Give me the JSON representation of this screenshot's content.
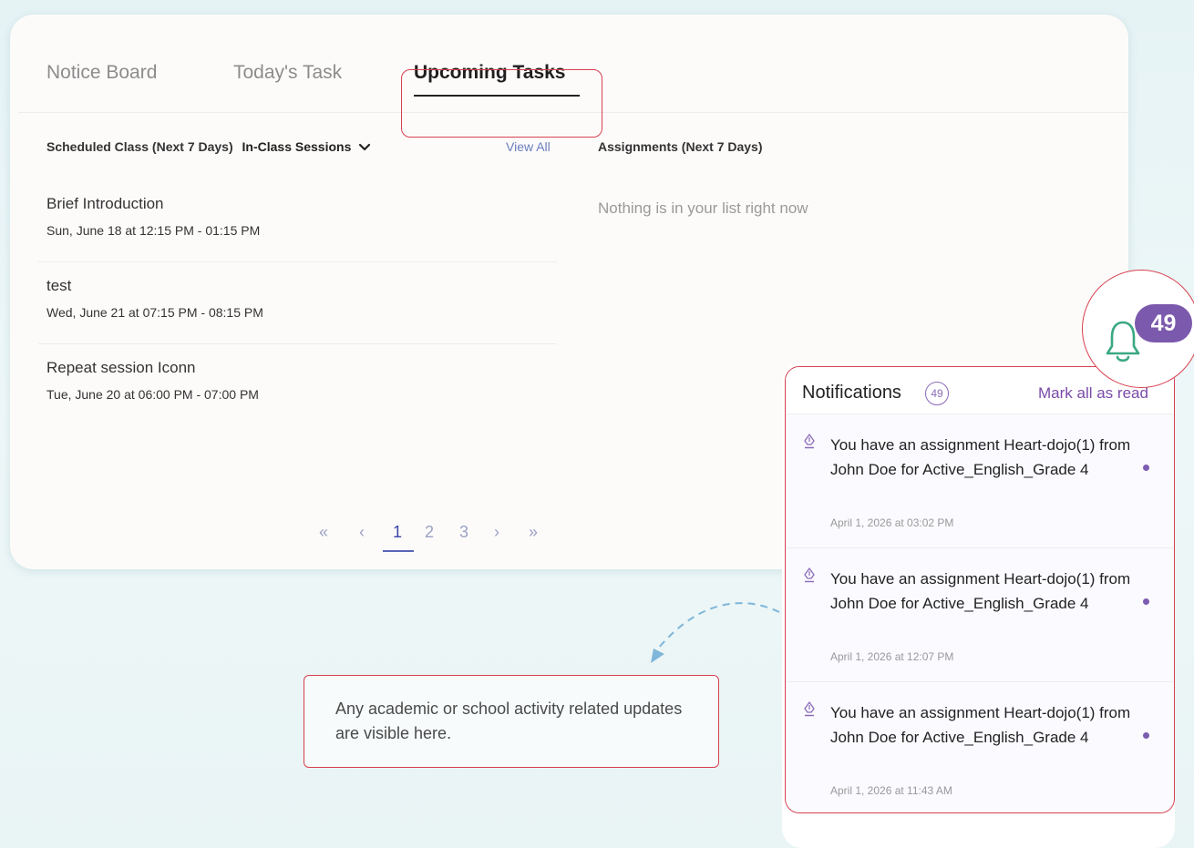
{
  "tabs": [
    {
      "label": "Notice Board"
    },
    {
      "label": "Today's Task"
    },
    {
      "label": "Upcoming Tasks",
      "active": true
    }
  ],
  "scheduled": {
    "heading": "Scheduled Class (Next 7 Days)",
    "filter": "In-Class Sessions",
    "view_all": "View All",
    "sessions": [
      {
        "title": "Brief Introduction",
        "when": "Sun, June 18 at 12:15 PM - 01:15 PM"
      },
      {
        "title": "test",
        "when": "Wed, June 21 at 07:15 PM - 08:15 PM"
      },
      {
        "title": "Repeat session Iconn",
        "when": "Tue, June 20 at 06:00 PM - 07:00 PM"
      }
    ]
  },
  "assignments": {
    "heading": "Assignments (Next 7 Days)",
    "empty": "Nothing is in your list right now"
  },
  "pagination": {
    "first": "«",
    "prev": "‹",
    "pages": [
      "1",
      "2",
      "3"
    ],
    "current": "1",
    "next": "›",
    "last": "»"
  },
  "annotation": {
    "text": "Any academic or school activity related updates are visible here."
  },
  "notifications": {
    "title": "Notifications",
    "count": "49",
    "mark_all": "Mark all as read",
    "items": [
      {
        "text": "You have an assignment Heart-dojo(1) from John Doe for Active_English_Grade 4",
        "time": "April 1, 2026 at 03:02 PM",
        "unread": true
      },
      {
        "text": "You have an assignment Heart-dojo(1) from John Doe for Active_English_Grade 4",
        "time": "April 1, 2026 at 12:07 PM",
        "unread": true
      },
      {
        "text": "You have an assignment Heart-dojo(1) from John Doe for Active_English_Grade 4",
        "time": "April 1, 2026 at 11:43 AM",
        "unread": true
      }
    ]
  },
  "bell": {
    "badge": "49",
    "icon": "bell-icon",
    "color": "#3aa882"
  },
  "colors": {
    "highlight": "#d6414f",
    "accent": "#7b59ad",
    "link": "#6a7fbf"
  }
}
